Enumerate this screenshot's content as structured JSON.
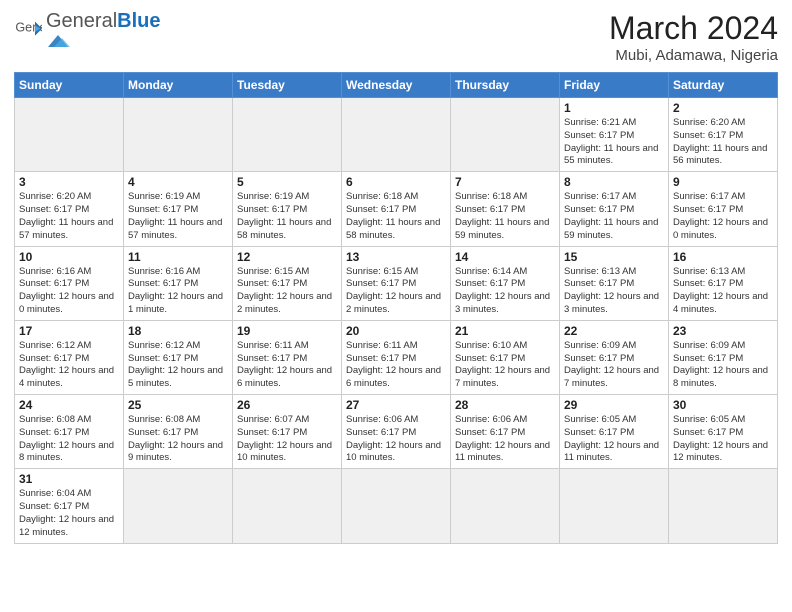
{
  "header": {
    "logo_general": "General",
    "logo_blue": "Blue",
    "title": "March 2024",
    "subtitle": "Mubi, Adamawa, Nigeria"
  },
  "weekdays": [
    "Sunday",
    "Monday",
    "Tuesday",
    "Wednesday",
    "Thursday",
    "Friday",
    "Saturday"
  ],
  "weeks": [
    [
      {
        "day": "",
        "info": "",
        "empty": true
      },
      {
        "day": "",
        "info": "",
        "empty": true
      },
      {
        "day": "",
        "info": "",
        "empty": true
      },
      {
        "day": "",
        "info": "",
        "empty": true
      },
      {
        "day": "",
        "info": "",
        "empty": true
      },
      {
        "day": "1",
        "info": "Sunrise: 6:21 AM\nSunset: 6:17 PM\nDaylight: 11 hours\nand 55 minutes.",
        "empty": false
      },
      {
        "day": "2",
        "info": "Sunrise: 6:20 AM\nSunset: 6:17 PM\nDaylight: 11 hours\nand 56 minutes.",
        "empty": false
      }
    ],
    [
      {
        "day": "3",
        "info": "Sunrise: 6:20 AM\nSunset: 6:17 PM\nDaylight: 11 hours\nand 57 minutes.",
        "empty": false
      },
      {
        "day": "4",
        "info": "Sunrise: 6:19 AM\nSunset: 6:17 PM\nDaylight: 11 hours\nand 57 minutes.",
        "empty": false
      },
      {
        "day": "5",
        "info": "Sunrise: 6:19 AM\nSunset: 6:17 PM\nDaylight: 11 hours\nand 58 minutes.",
        "empty": false
      },
      {
        "day": "6",
        "info": "Sunrise: 6:18 AM\nSunset: 6:17 PM\nDaylight: 11 hours\nand 58 minutes.",
        "empty": false
      },
      {
        "day": "7",
        "info": "Sunrise: 6:18 AM\nSunset: 6:17 PM\nDaylight: 11 hours\nand 59 minutes.",
        "empty": false
      },
      {
        "day": "8",
        "info": "Sunrise: 6:17 AM\nSunset: 6:17 PM\nDaylight: 11 hours\nand 59 minutes.",
        "empty": false
      },
      {
        "day": "9",
        "info": "Sunrise: 6:17 AM\nSunset: 6:17 PM\nDaylight: 12 hours\nand 0 minutes.",
        "empty": false
      }
    ],
    [
      {
        "day": "10",
        "info": "Sunrise: 6:16 AM\nSunset: 6:17 PM\nDaylight: 12 hours\nand 0 minutes.",
        "empty": false
      },
      {
        "day": "11",
        "info": "Sunrise: 6:16 AM\nSunset: 6:17 PM\nDaylight: 12 hours\nand 1 minute.",
        "empty": false
      },
      {
        "day": "12",
        "info": "Sunrise: 6:15 AM\nSunset: 6:17 PM\nDaylight: 12 hours\nand 2 minutes.",
        "empty": false
      },
      {
        "day": "13",
        "info": "Sunrise: 6:15 AM\nSunset: 6:17 PM\nDaylight: 12 hours\nand 2 minutes.",
        "empty": false
      },
      {
        "day": "14",
        "info": "Sunrise: 6:14 AM\nSunset: 6:17 PM\nDaylight: 12 hours\nand 3 minutes.",
        "empty": false
      },
      {
        "day": "15",
        "info": "Sunrise: 6:13 AM\nSunset: 6:17 PM\nDaylight: 12 hours\nand 3 minutes.",
        "empty": false
      },
      {
        "day": "16",
        "info": "Sunrise: 6:13 AM\nSunset: 6:17 PM\nDaylight: 12 hours\nand 4 minutes.",
        "empty": false
      }
    ],
    [
      {
        "day": "17",
        "info": "Sunrise: 6:12 AM\nSunset: 6:17 PM\nDaylight: 12 hours\nand 4 minutes.",
        "empty": false
      },
      {
        "day": "18",
        "info": "Sunrise: 6:12 AM\nSunset: 6:17 PM\nDaylight: 12 hours\nand 5 minutes.",
        "empty": false
      },
      {
        "day": "19",
        "info": "Sunrise: 6:11 AM\nSunset: 6:17 PM\nDaylight: 12 hours\nand 6 minutes.",
        "empty": false
      },
      {
        "day": "20",
        "info": "Sunrise: 6:11 AM\nSunset: 6:17 PM\nDaylight: 12 hours\nand 6 minutes.",
        "empty": false
      },
      {
        "day": "21",
        "info": "Sunrise: 6:10 AM\nSunset: 6:17 PM\nDaylight: 12 hours\nand 7 minutes.",
        "empty": false
      },
      {
        "day": "22",
        "info": "Sunrise: 6:09 AM\nSunset: 6:17 PM\nDaylight: 12 hours\nand 7 minutes.",
        "empty": false
      },
      {
        "day": "23",
        "info": "Sunrise: 6:09 AM\nSunset: 6:17 PM\nDaylight: 12 hours\nand 8 minutes.",
        "empty": false
      }
    ],
    [
      {
        "day": "24",
        "info": "Sunrise: 6:08 AM\nSunset: 6:17 PM\nDaylight: 12 hours\nand 8 minutes.",
        "empty": false
      },
      {
        "day": "25",
        "info": "Sunrise: 6:08 AM\nSunset: 6:17 PM\nDaylight: 12 hours\nand 9 minutes.",
        "empty": false
      },
      {
        "day": "26",
        "info": "Sunrise: 6:07 AM\nSunset: 6:17 PM\nDaylight: 12 hours\nand 10 minutes.",
        "empty": false
      },
      {
        "day": "27",
        "info": "Sunrise: 6:06 AM\nSunset: 6:17 PM\nDaylight: 12 hours\nand 10 minutes.",
        "empty": false
      },
      {
        "day": "28",
        "info": "Sunrise: 6:06 AM\nSunset: 6:17 PM\nDaylight: 12 hours\nand 11 minutes.",
        "empty": false
      },
      {
        "day": "29",
        "info": "Sunrise: 6:05 AM\nSunset: 6:17 PM\nDaylight: 12 hours\nand 11 minutes.",
        "empty": false
      },
      {
        "day": "30",
        "info": "Sunrise: 6:05 AM\nSunset: 6:17 PM\nDaylight: 12 hours\nand 12 minutes.",
        "empty": false
      }
    ],
    [
      {
        "day": "31",
        "info": "Sunrise: 6:04 AM\nSunset: 6:17 PM\nDaylight: 12 hours\nand 12 minutes.",
        "empty": false
      },
      {
        "day": "",
        "info": "",
        "empty": true
      },
      {
        "day": "",
        "info": "",
        "empty": true
      },
      {
        "day": "",
        "info": "",
        "empty": true
      },
      {
        "day": "",
        "info": "",
        "empty": true
      },
      {
        "day": "",
        "info": "",
        "empty": true
      },
      {
        "day": "",
        "info": "",
        "empty": true
      }
    ]
  ]
}
